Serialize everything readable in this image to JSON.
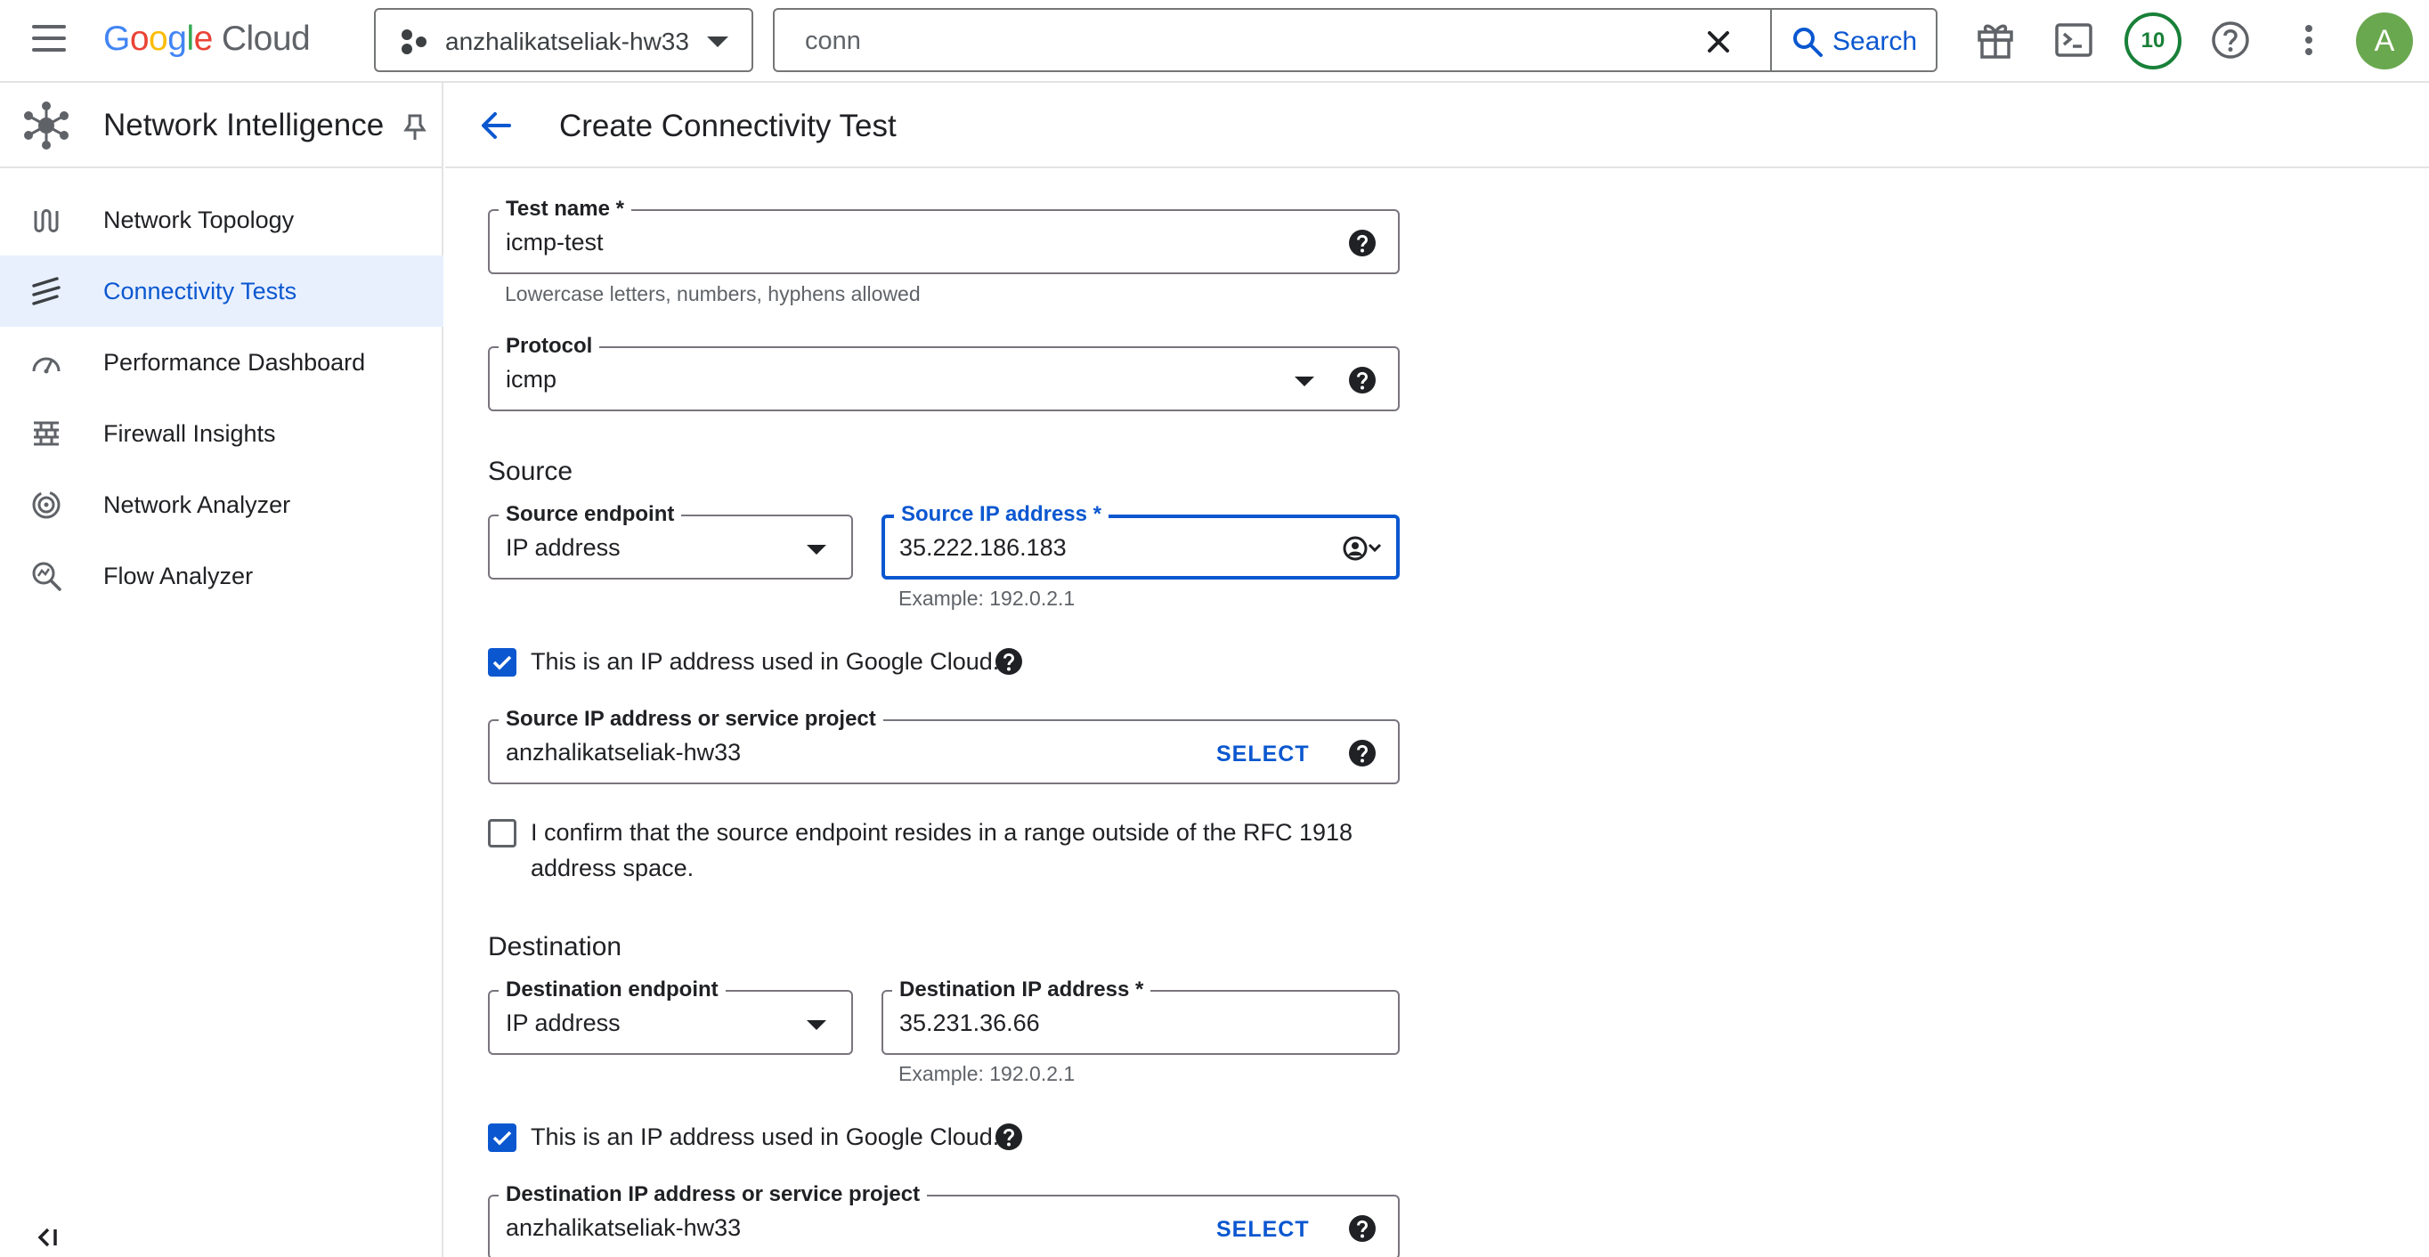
{
  "topbar": {
    "logo_google": "Google",
    "logo_cloud": "Cloud",
    "project_name": "anzhalikatseliak-hw33",
    "search_value": "conn",
    "search_label": "Search",
    "notifications_count": "10",
    "avatar_letter": "A"
  },
  "sidebar": {
    "title": "Network Intelligence",
    "items": [
      {
        "label": "Network Topology",
        "icon": "network-topology-icon"
      },
      {
        "label": "Connectivity Tests",
        "icon": "connectivity-tests-icon",
        "active": true
      },
      {
        "label": "Performance Dashboard",
        "icon": "performance-dashboard-icon"
      },
      {
        "label": "Firewall Insights",
        "icon": "firewall-insights-icon"
      },
      {
        "label": "Network Analyzer",
        "icon": "network-analyzer-icon"
      },
      {
        "label": "Flow Analyzer",
        "icon": "flow-analyzer-icon"
      }
    ]
  },
  "page": {
    "title": "Create Connectivity Test"
  },
  "form": {
    "test_name": {
      "label": "Test name *",
      "value": "icmp-test",
      "hint": "Lowercase letters, numbers, hyphens allowed"
    },
    "protocol": {
      "label": "Protocol",
      "value": "icmp"
    },
    "source_heading": "Source",
    "source_endpoint": {
      "label": "Source endpoint",
      "value": "IP address"
    },
    "source_ip": {
      "label": "Source IP address *",
      "value": "35.222.186.183",
      "hint": "Example: 192.0.2.1"
    },
    "source_gcloud_checkbox": {
      "label": "This is an IP address used in Google Cloud.",
      "checked": true
    },
    "source_project": {
      "label": "Source IP address or service project",
      "value": "anzhalikatseliak-hw33",
      "select_label": "SELECT"
    },
    "rfc_checkbox": {
      "label_line1": "I confirm that the source endpoint resides in a range outside of the RFC 1918",
      "label_line2": "address space.",
      "checked": false
    },
    "destination_heading": "Destination",
    "destination_endpoint": {
      "label": "Destination endpoint",
      "value": "IP address"
    },
    "destination_ip": {
      "label": "Destination IP address *",
      "value": "35.231.36.66",
      "hint": "Example: 192.0.2.1"
    },
    "dest_gcloud_checkbox": {
      "label": "This is an IP address used in Google Cloud.",
      "checked": true
    },
    "destination_project": {
      "label": "Destination IP address or service project",
      "value": "anzhalikatseliak-hw33",
      "select_label": "SELECT"
    }
  },
  "colors": {
    "accent": "#0b57d0",
    "active_bg": "#e8f0fe",
    "badge_green": "#188038",
    "avatar_bg": "#6aa84f"
  }
}
